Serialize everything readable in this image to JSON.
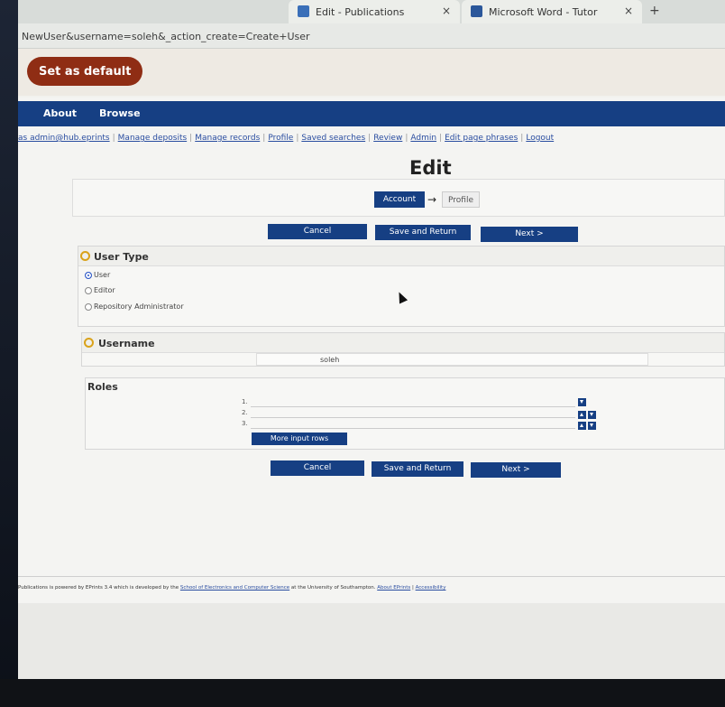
{
  "browser": {
    "tabs": [
      {
        "label": "Edit - Publications",
        "close": "×"
      },
      {
        "label": "Microsoft Word - Tutor",
        "close": "×"
      }
    ],
    "new_tab": "+",
    "url": "NewUser&username=soleh&_action_create=Create+User"
  },
  "banner": {
    "set_default": "Set as default"
  },
  "nav": {
    "about": "About",
    "browse": "Browse"
  },
  "subnav": {
    "prefix": "as admin@hub.eprints",
    "links": [
      "Manage deposits",
      "Manage records",
      "Profile",
      "Saved searches",
      "Review",
      "Admin",
      "Edit page phrases",
      "Logout"
    ]
  },
  "page": {
    "title": "Edit"
  },
  "stages": {
    "current": "Account",
    "arrow": "→",
    "next": "Profile"
  },
  "actions": {
    "cancel": "Cancel",
    "save_return": "Save and Return",
    "next": "Next >"
  },
  "user_type": {
    "title": "User Type",
    "options": [
      "User",
      "Editor",
      "Repository Administrator"
    ],
    "selected": "User"
  },
  "username": {
    "title": "Username",
    "value": "soleh"
  },
  "roles": {
    "title": "Roles",
    "rows": [
      "1.",
      "2.",
      "3."
    ],
    "more_rows": "More input rows"
  },
  "footer": {
    "text_1": "Publications is powered by EPrints 3.4 which is developed by the",
    "link_school": "School of Electronics and Computer Science",
    "text_2": "at the University of Southampton.",
    "link_about": "About EPrints",
    "sep": "|",
    "link_access": "Accessibility"
  },
  "colors": {
    "nav_blue": "#163f83",
    "set_default": "#8f2d14",
    "required": "#d9a21a"
  }
}
